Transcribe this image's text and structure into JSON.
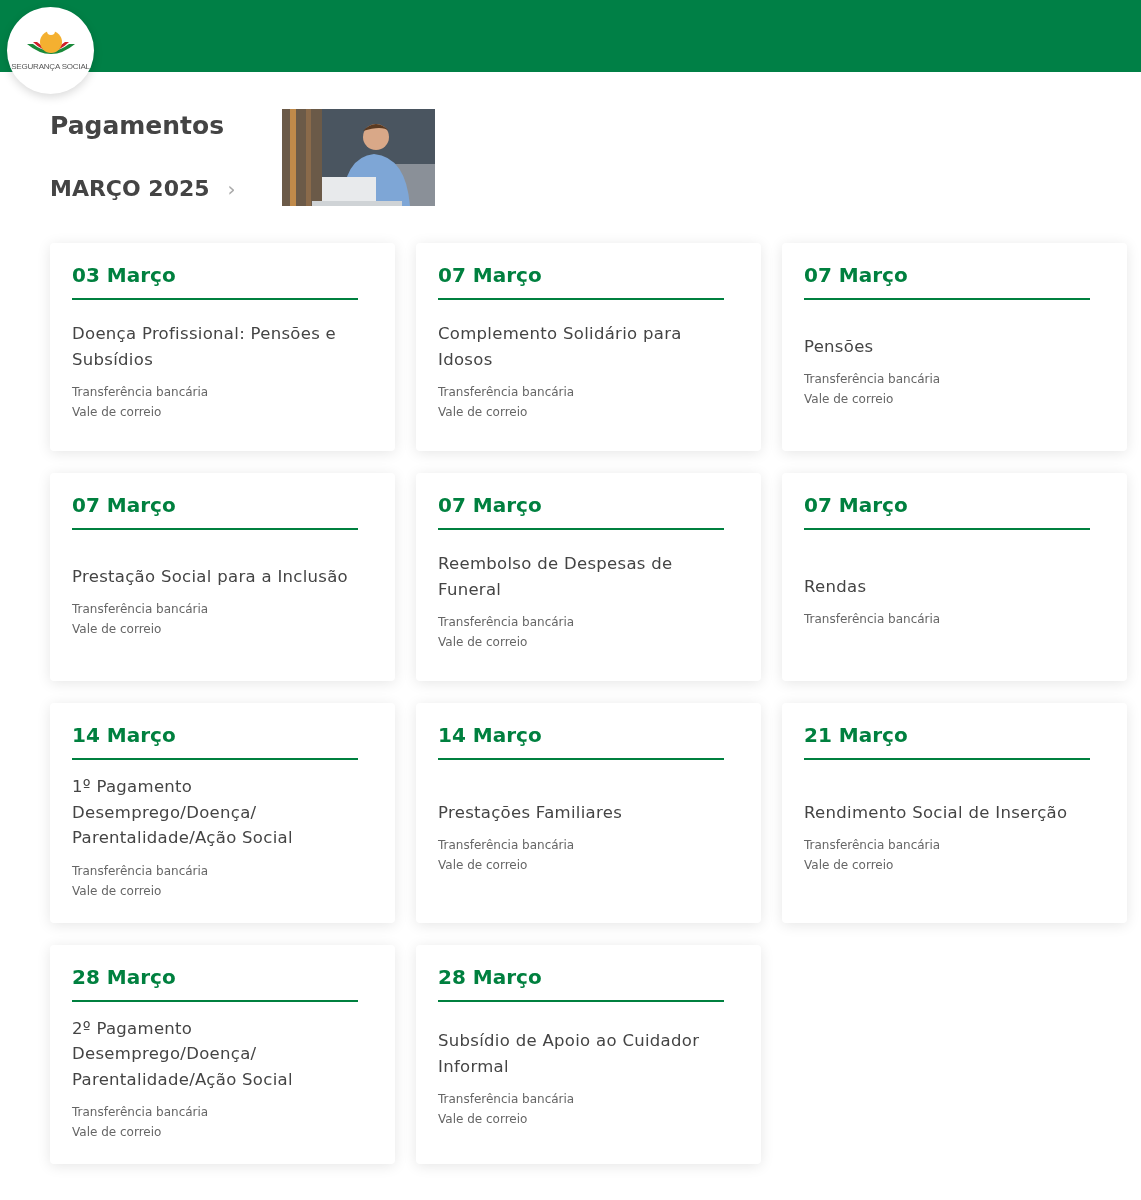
{
  "logo": {
    "caption": "SEGURANÇA SOCIAL"
  },
  "page_title": "Pagamentos",
  "month": {
    "label": "MARÇO 2025",
    "next_icon": "›"
  },
  "cards": [
    {
      "date": "03 Março",
      "title": "Doença Profissional: Pensões e Subsídios",
      "methods": [
        "Transferência bancária",
        "Vale de correio"
      ]
    },
    {
      "date": "07 Março",
      "title": "Complemento Solidário para Idosos",
      "methods": [
        "Transferência bancária",
        "Vale de correio"
      ]
    },
    {
      "date": "07 Março",
      "title": "Pensões",
      "methods": [
        "Transferência bancária",
        "Vale de correio"
      ]
    },
    {
      "date": "07 Março",
      "title": "Prestação Social para a Inclusão",
      "methods": [
        "Transferência bancária",
        "Vale de correio"
      ]
    },
    {
      "date": "07 Março",
      "title": "Reembolso de Despesas de Funeral",
      "methods": [
        "Transferência bancária",
        "Vale de correio"
      ]
    },
    {
      "date": "07 Março",
      "title": "Rendas",
      "methods": [
        "Transferência bancária"
      ]
    },
    {
      "date": "14 Março",
      "title": "1º Pagamento Desemprego/Doença/ Parentalidade/Ação Social",
      "methods": [
        "Transferência bancária",
        "Vale de correio"
      ]
    },
    {
      "date": "14 Março",
      "title": "Prestações Familiares",
      "methods": [
        "Transferência bancária",
        "Vale de correio"
      ]
    },
    {
      "date": "21 Março",
      "title": "Rendimento Social de Inserção",
      "methods": [
        "Transferência bancária",
        "Vale de correio"
      ]
    },
    {
      "date": "28 Março",
      "title": "2º Pagamento Desemprego/Doença/ Parentalidade/Ação Social",
      "methods": [
        "Transferência bancária",
        "Vale de correio"
      ]
    },
    {
      "date": "28 Março",
      "title": "Subsídio de Apoio ao Cuidador Informal",
      "methods": [
        "Transferência bancária",
        "Vale de correio"
      ]
    }
  ]
}
